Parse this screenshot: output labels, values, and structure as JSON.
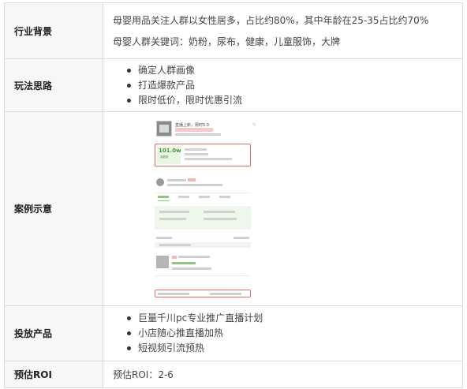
{
  "rows": {
    "industry": {
      "label": "行业背景",
      "lines": [
        "母婴用品关注人群以女性居多，占比约80%，其中年龄在25-35占比约70%",
        "母婴人群关键词：奶粉，尿布，健康，儿童服饰，大牌"
      ]
    },
    "approach": {
      "label": "玩法思路",
      "items": [
        "确定人群画像",
        "打造爆款产品",
        "限时低价，限时优惠引流"
      ]
    },
    "case": {
      "label": "案例示意",
      "mock": {
        "live_title": "直播上新，限时5.0",
        "big_value": "101.0w",
        "big_caption": "观看数"
      }
    },
    "product": {
      "label": "投放产品",
      "items": [
        "巨量千川pc专业推广直播计划",
        "小店随心推直播加热",
        "短视频引流预热"
      ]
    },
    "roi": {
      "label": "预估ROI",
      "value": "预估ROI：2-6"
    }
  },
  "colors": {
    "header_bg": "#f7f7f7",
    "border": "#dcdcdc",
    "highlight_red": "#e06a6a",
    "highlight_green": "#4a9a3a"
  }
}
